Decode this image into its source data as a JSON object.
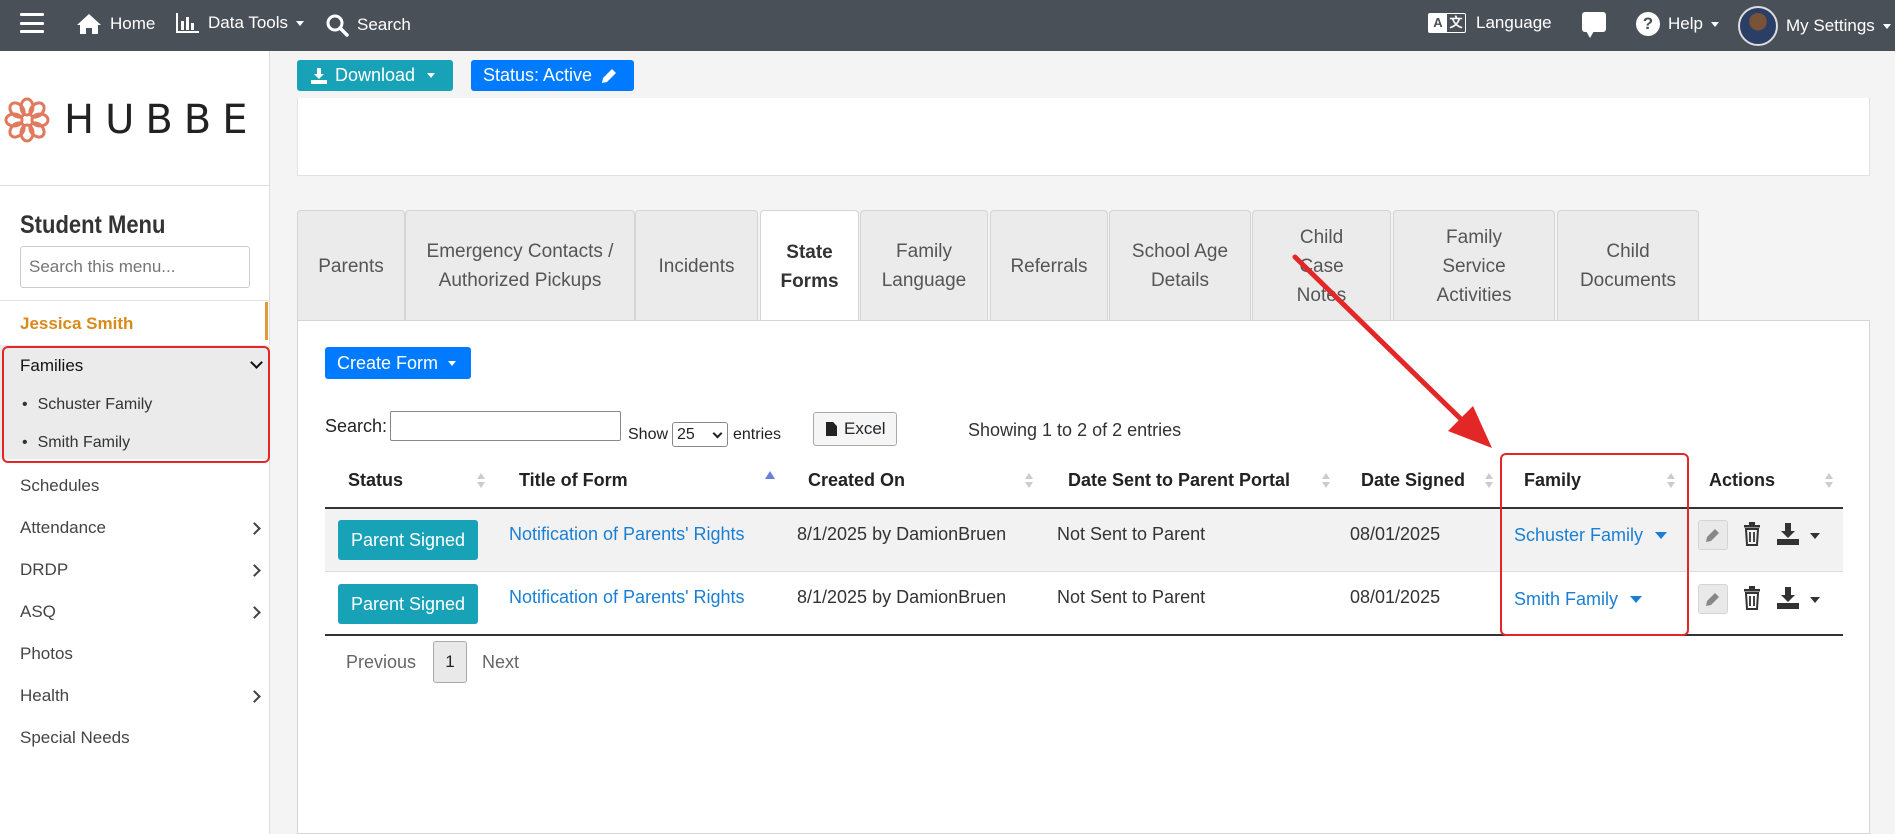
{
  "navbar": {
    "home": "Home",
    "data_tools": "Data Tools",
    "search": "Search",
    "language": "Language",
    "help": "Help",
    "my_settings": "My Settings",
    "language_icon_left": "A",
    "language_icon_right": "文"
  },
  "sidebar": {
    "logo_text": "HUBBE",
    "menu_title": "Student Menu",
    "search_placeholder": "Search this menu...",
    "student_name": "Jessica Smith",
    "families": {
      "label": "Families",
      "items": [
        "Schuster Family",
        "Smith Family"
      ]
    },
    "items": [
      {
        "label": "Schedules"
      },
      {
        "label": "Attendance"
      },
      {
        "label": "DRDP"
      },
      {
        "label": "ASQ"
      },
      {
        "label": "Photos"
      },
      {
        "label": "Health"
      },
      {
        "label": "Special Needs"
      }
    ]
  },
  "toolbar": {
    "download": "Download",
    "status": "Status: Active"
  },
  "tabs": [
    {
      "label": "Parents"
    },
    {
      "label": "Emergency Contacts / Authorized Pickups"
    },
    {
      "label": "Incidents"
    },
    {
      "label": "State Forms"
    },
    {
      "label": "Family Language"
    },
    {
      "label": "Referrals"
    },
    {
      "label": "School Age Details"
    },
    {
      "label": "Child Case Notes"
    },
    {
      "label": "Family Service Activities"
    },
    {
      "label": "Child Documents"
    }
  ],
  "panel": {
    "create_form": "Create Form",
    "search_label": "Search:",
    "show_label": "Show",
    "page_size": "25",
    "entries_label": "entries",
    "excel": "Excel",
    "info": "Showing 1 to 2 of 2 entries"
  },
  "table": {
    "columns": [
      "Status",
      "Title of Form",
      "Created On",
      "Date Sent to Parent Portal",
      "Date Signed",
      "Family",
      "Actions"
    ],
    "rows": [
      {
        "status": "Parent Signed",
        "title": "Notification of Parents' Rights",
        "created": "8/1/2025 by DamionBruen",
        "sent": "Not Sent to Parent",
        "signed": "08/01/2025",
        "family": "Schuster Family"
      },
      {
        "status": "Parent Signed",
        "title": "Notification of Parents' Rights",
        "created": "8/1/2025 by DamionBruen",
        "sent": "Not Sent to Parent",
        "signed": "08/01/2025",
        "family": "Smith Family"
      }
    ]
  },
  "pagination": {
    "previous": "Previous",
    "current": "1",
    "next": "Next"
  },
  "colors": {
    "navbar": "#4a5058",
    "primary": "#007bff",
    "info": "#17a2b8",
    "accent_orange": "#d88a1a",
    "annotation_red": "#e32626"
  },
  "icons": {
    "hamburger": "hamburger-icon",
    "home": "home-icon",
    "chart": "bar-chart-icon",
    "search": "search-icon",
    "language": "translate-icon",
    "chat": "chat-icon",
    "help": "help-icon",
    "download": "download-icon",
    "pencil": "pencil-icon",
    "file": "file-icon",
    "trash": "trash-icon"
  }
}
